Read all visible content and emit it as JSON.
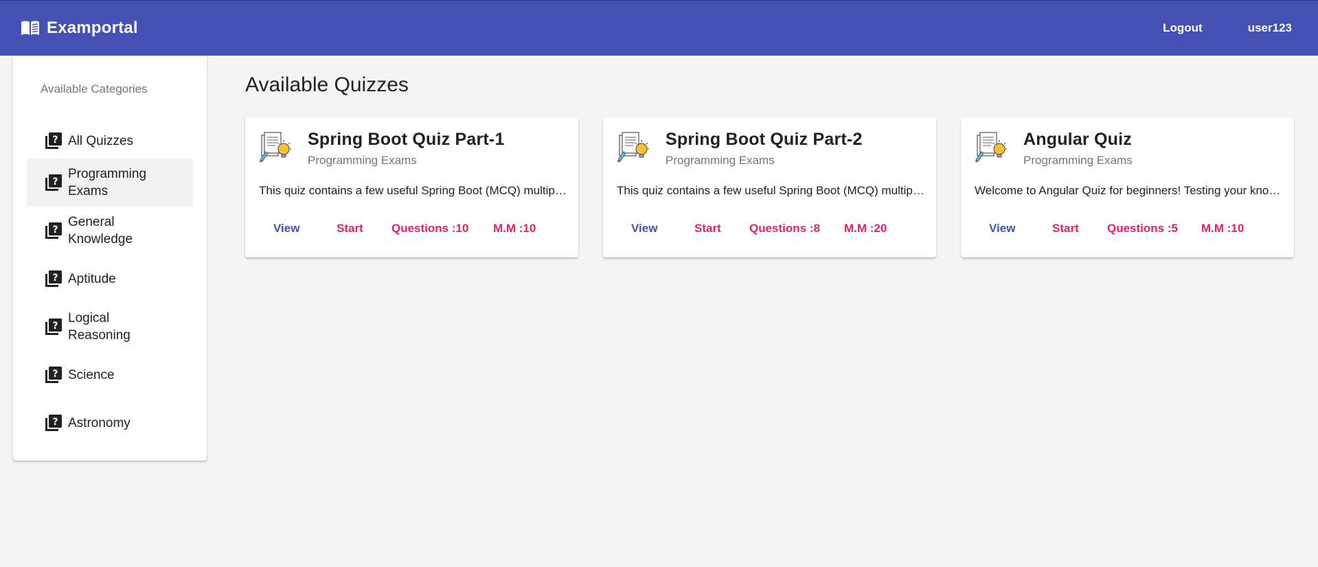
{
  "app": {
    "title": "Examportal",
    "brand_icon": "menu-book-icon",
    "accent_color": "#4551b3"
  },
  "nav": {
    "logout_label": "Logout",
    "username": "user123"
  },
  "sidebar": {
    "heading": "Available Categories",
    "active_index": 1,
    "items": [
      {
        "label": "All Quizzes",
        "icon": "quiz-icon"
      },
      {
        "label": "Programming Exams",
        "icon": "quiz-icon"
      },
      {
        "label": "General Knowledge",
        "icon": "quiz-icon"
      },
      {
        "label": "Aptitude",
        "icon": "quiz-icon"
      },
      {
        "label": "Logical Reasoning",
        "icon": "quiz-icon"
      },
      {
        "label": "Science",
        "icon": "quiz-icon"
      },
      {
        "label": "Astronomy",
        "icon": "quiz-icon"
      }
    ]
  },
  "main": {
    "title": "Available Quizzes",
    "quizzes": [
      {
        "title": "Spring Boot Quiz Part-1",
        "category": "Programming Exams",
        "description": "This quiz contains a few useful Spring Boot (MCQ) multiple choice questions",
        "view_label": "View",
        "start_label": "Start",
        "questions_label": "Questions :10",
        "max_marks_label": "M.M :10"
      },
      {
        "title": "Spring Boot Quiz Part-2",
        "category": "Programming Exams",
        "description": "This quiz contains a few useful Spring Boot (MCQ) multiple choice questions",
        "view_label": "View",
        "start_label": "Start",
        "questions_label": "Questions :8",
        "max_marks_label": "M.M :20"
      },
      {
        "title": "Angular Quiz",
        "category": "Programming Exams",
        "description": "Welcome to Angular Quiz for beginners! Testing your knowledge of Angular basics",
        "view_label": "View",
        "start_label": "Start",
        "questions_label": "Questions :5",
        "max_marks_label": "M.M :10"
      }
    ]
  }
}
